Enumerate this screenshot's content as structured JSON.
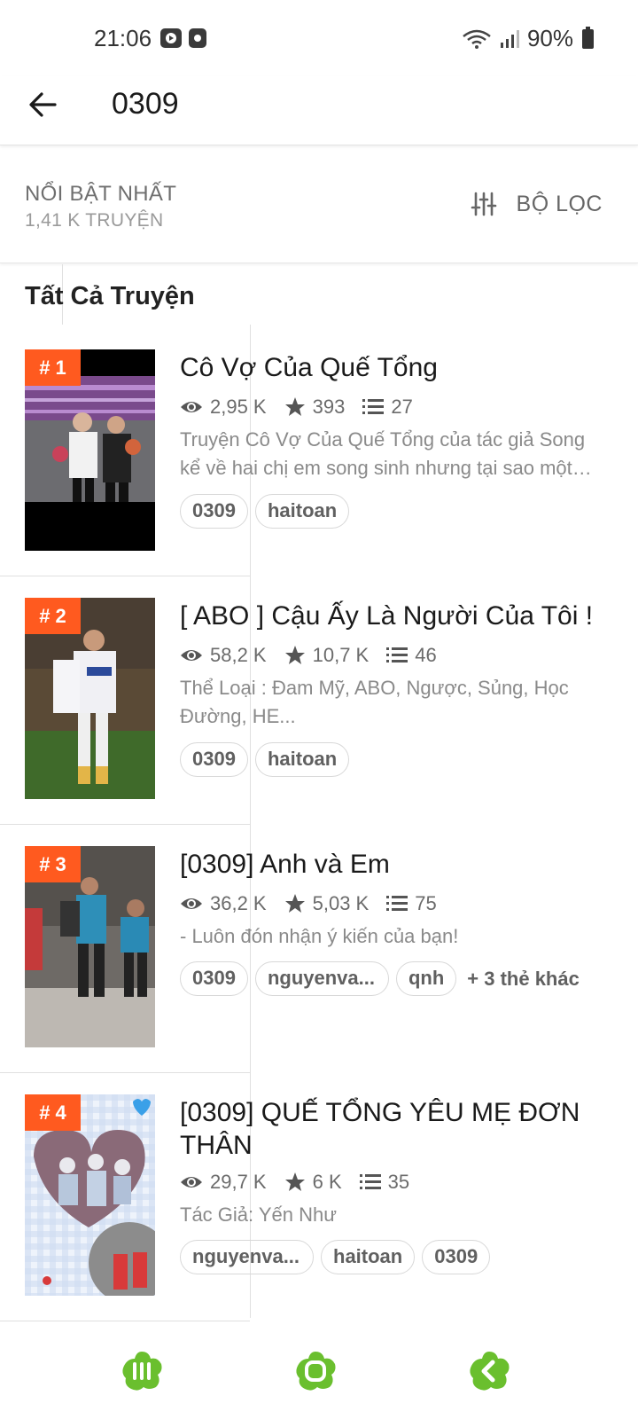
{
  "status": {
    "time": "21:06",
    "battery": "90%"
  },
  "header": {
    "title": "0309"
  },
  "sort": {
    "label": "NỔI BẬT NHẤT",
    "count": "1,41 K TRUYỆN",
    "filter_label": "BỘ LỌC"
  },
  "section": {
    "title": "Tất Cả Truyện"
  },
  "stories": [
    {
      "rank": "# 1",
      "title": "Cô Vợ Của Quế Tổng",
      "reads": "2,95 K",
      "votes": "393",
      "parts": "27",
      "description": "Truyện Cô Vợ Của Quế Tổng của tác giả Song kể về hai chị em song sinh nhưng tại sao một…",
      "tags": [
        "0309",
        "haitoan"
      ]
    },
    {
      "rank": "# 2",
      "title": "[ ABO ] Cậu Ấy Là Người Của Tôi !",
      "reads": "58,2 K",
      "votes": "10,7 K",
      "parts": "46",
      "description": "Thể Loại : Đam Mỹ, ABO, Ngược, Sủng, Học Đường, HE...",
      "tags": [
        "0309",
        "haitoan"
      ]
    },
    {
      "rank": "# 3",
      "title": "[0309] Anh và Em",
      "reads": "36,2 K",
      "votes": "5,03 K",
      "parts": "75",
      "description": "- Luôn đón nhận ý kiến của bạn!",
      "tags": [
        "0309",
        "nguyenva...",
        "qnh"
      ],
      "more_tags": "+ 3 thẻ khác"
    },
    {
      "rank": "# 4",
      "title": "[0309] QUẾ TỔNG YÊU MẸ ĐƠN THÂN",
      "reads": "29,7 K",
      "votes": "6 K",
      "parts": "35",
      "description": "Tác Giả: Yến Như",
      "tags": [
        "nguyenva...",
        "haitoan",
        "0309"
      ]
    }
  ],
  "colors": {
    "rank_badge": "#ff5a1f",
    "nav_icon": "#6abf2e"
  },
  "icons": [
    "back-arrow-icon",
    "filter-sliders-icon",
    "eye-icon",
    "star-icon",
    "list-icon"
  ]
}
